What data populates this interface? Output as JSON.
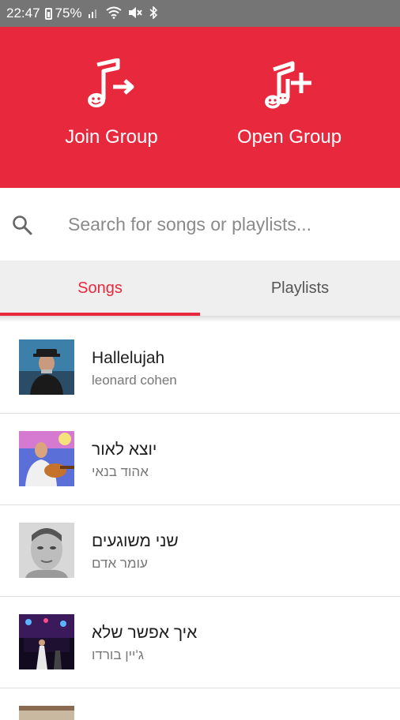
{
  "status_bar": {
    "time": "22:47",
    "battery": "75%",
    "icons": [
      "battery-icon",
      "signal-icon",
      "wifi-icon",
      "mute-icon",
      "bluetooth-icon"
    ]
  },
  "colors": {
    "accent": "#e8283c",
    "status_bar": "#757575",
    "tab_bg": "#efefef"
  },
  "header": {
    "join_group": {
      "label": "Join Group",
      "icon": "music-note-arrow-icon"
    },
    "open_group": {
      "label": "Open Group",
      "icon": "music-notes-plus-icon"
    }
  },
  "search": {
    "placeholder": "Search for songs or playlists...",
    "value": ""
  },
  "tabs": [
    {
      "label": "Songs",
      "selected": true
    },
    {
      "label": "Playlists",
      "selected": false
    }
  ],
  "songs": [
    {
      "title": "Hallelujah",
      "artist": "leonard cohen"
    },
    {
      "title": "יוצא לאור",
      "artist": "אהוד בנאי"
    },
    {
      "title": "שני משוגעים",
      "artist": "עומר אדם"
    },
    {
      "title": "איך אפשר שלא",
      "artist": "ג'יין בורדו"
    }
  ]
}
